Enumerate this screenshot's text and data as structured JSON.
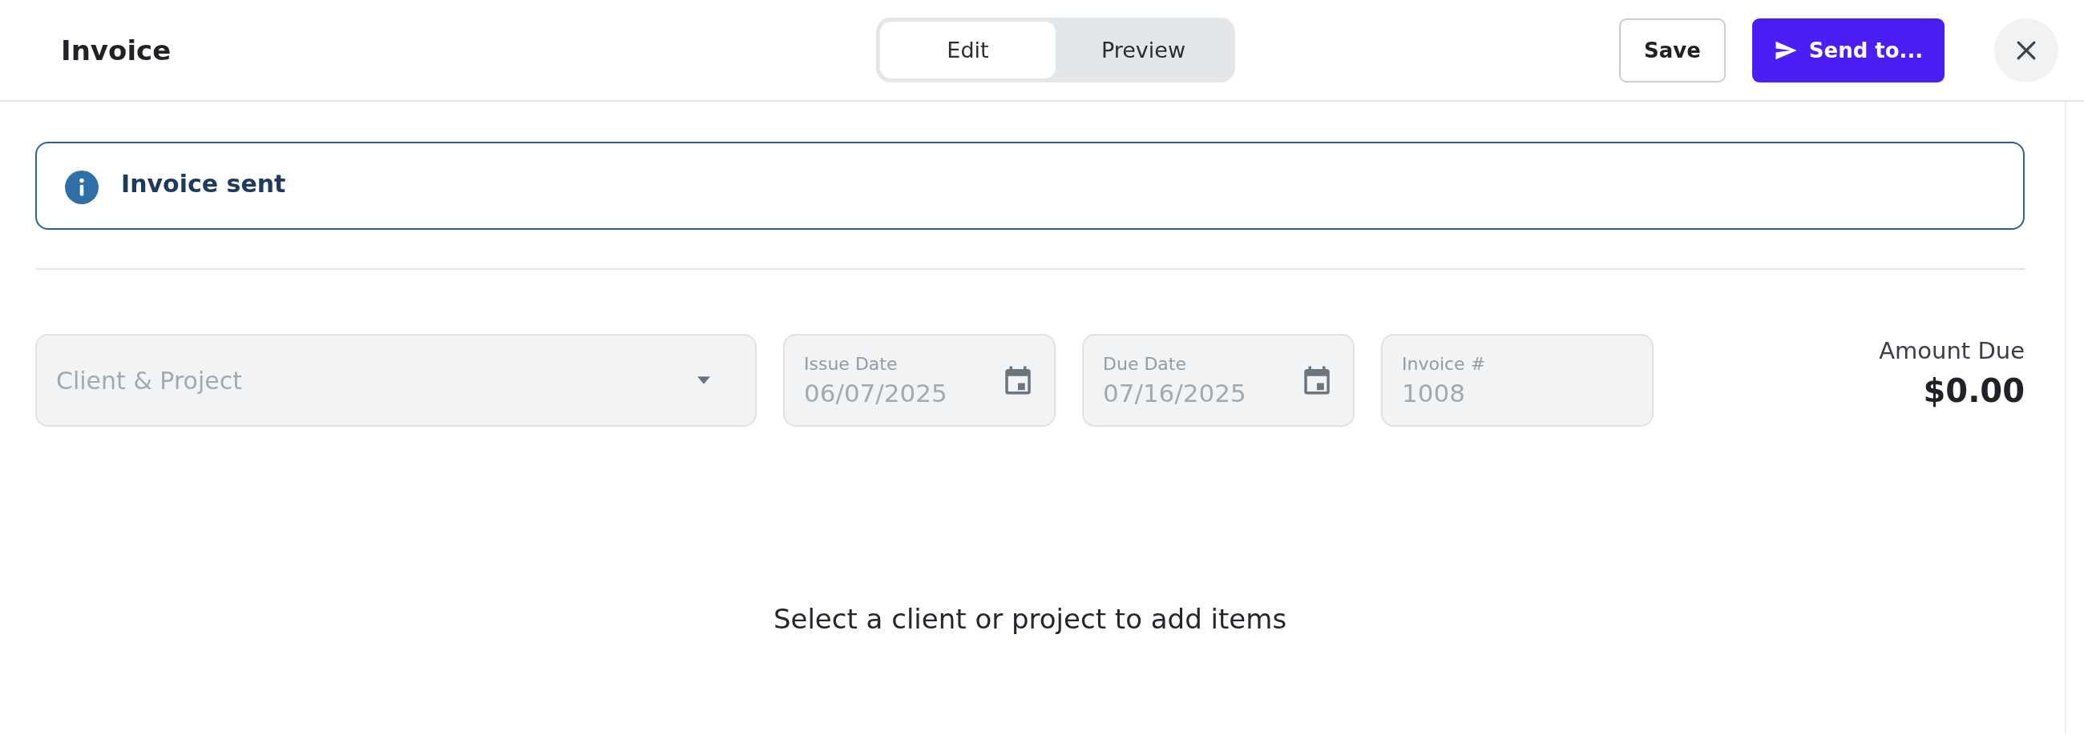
{
  "header": {
    "title": "Invoice",
    "tabs": [
      {
        "label": "Edit",
        "selected": true
      },
      {
        "label": "Preview",
        "selected": false
      }
    ],
    "buttons": [
      {
        "label": "Save",
        "kind": "secondary"
      },
      {
        "label": "Send to...",
        "kind": "primary"
      }
    ]
  },
  "alert": {
    "text": "Invoice sent"
  },
  "fields": [
    {
      "kind": "select",
      "placeholder": "Client & Project",
      "disabled": true
    },
    {
      "kind": "date",
      "label": "Issue Date",
      "value": "06/07/2025",
      "disabled": true
    },
    {
      "kind": "date",
      "label": "Due Date",
      "value": "07/16/2025",
      "disabled": true
    },
    {
      "kind": "text",
      "label": "Invoice #",
      "value": "1008",
      "disabled": true
    }
  ],
  "amount": {
    "label": "Amount Due",
    "value": "$0.00"
  },
  "empty_message": "Select a client or project to add items"
}
